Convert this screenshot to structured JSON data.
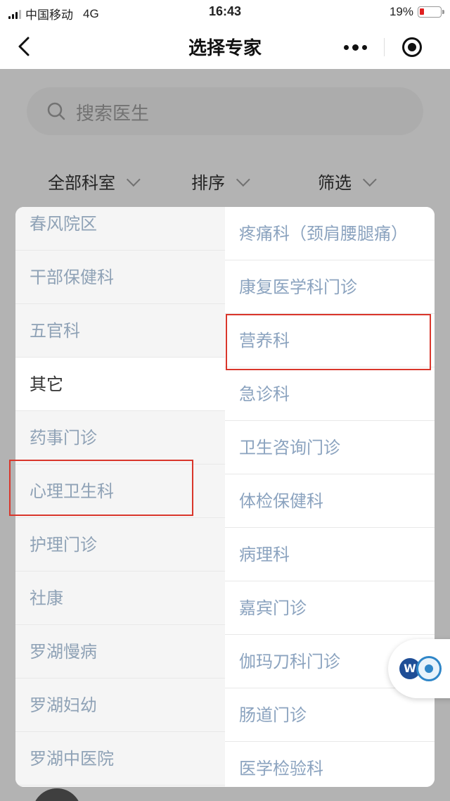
{
  "status_bar": {
    "carrier": "中国移动",
    "network": "4G",
    "time": "16:43",
    "battery": "19%"
  },
  "nav": {
    "title": "选择专家"
  },
  "search": {
    "placeholder": "搜索医生"
  },
  "filters": [
    {
      "label": "全部科室"
    },
    {
      "label": "排序"
    },
    {
      "label": "筛选"
    }
  ],
  "departments": {
    "left": [
      {
        "label": "春风院区"
      },
      {
        "label": "干部保健科"
      },
      {
        "label": "五官科"
      },
      {
        "label": "其它",
        "selected": true
      },
      {
        "label": "药事门诊"
      },
      {
        "label": "心理卫生科"
      },
      {
        "label": "护理门诊"
      },
      {
        "label": "社康"
      },
      {
        "label": "罗湖慢病"
      },
      {
        "label": "罗湖妇幼"
      },
      {
        "label": "罗湖中医院"
      }
    ],
    "right": [
      {
        "label": "疼痛科（颈肩腰腿痛）"
      },
      {
        "label": "康复医学科门诊"
      },
      {
        "label": "营养科"
      },
      {
        "label": "急诊科"
      },
      {
        "label": "卫生咨询门诊"
      },
      {
        "label": "体检保健科"
      },
      {
        "label": "病理科"
      },
      {
        "label": "嘉宾门诊"
      },
      {
        "label": "伽玛刀科门诊"
      },
      {
        "label": "肠道门诊"
      },
      {
        "label": "医学检验科"
      }
    ]
  },
  "float_button": {
    "letter": "W"
  },
  "colors": {
    "highlight": "#d9362b",
    "selected_text": "#333333",
    "dept_text": "#8ba3bf"
  }
}
